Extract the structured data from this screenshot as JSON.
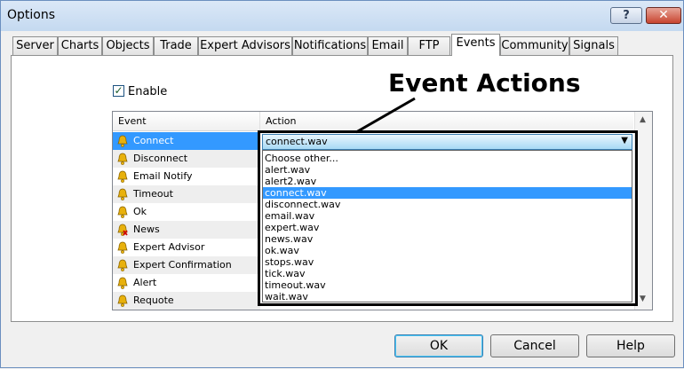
{
  "window": {
    "title": "Options",
    "help_glyph": "?",
    "close_glyph": "✕"
  },
  "tabs": [
    {
      "label": "Server"
    },
    {
      "label": "Charts"
    },
    {
      "label": "Objects"
    },
    {
      "label": "Trade"
    },
    {
      "label": "Expert Advisors"
    },
    {
      "label": "Notifications"
    },
    {
      "label": "Email"
    },
    {
      "label": "FTP"
    },
    {
      "label": "Events",
      "active": true
    },
    {
      "label": "Community"
    },
    {
      "label": "Signals"
    }
  ],
  "enable": {
    "label": "Enable",
    "checked": true
  },
  "annotation": "Event Actions",
  "list": {
    "columns": {
      "event": "Event",
      "action": "Action"
    },
    "events": [
      {
        "label": "Connect",
        "icon": "bell-icon",
        "selected": true
      },
      {
        "label": "Disconnect",
        "icon": "bell-icon"
      },
      {
        "label": "Email Notify",
        "icon": "bell-icon"
      },
      {
        "label": "Timeout",
        "icon": "bell-icon"
      },
      {
        "label": "Ok",
        "icon": "bell-icon"
      },
      {
        "label": "News",
        "icon": "bell-disabled-icon"
      },
      {
        "label": "Expert Advisor",
        "icon": "bell-icon"
      },
      {
        "label": "Expert Confirmation",
        "icon": "bell-icon"
      },
      {
        "label": "Alert",
        "icon": "bell-icon"
      },
      {
        "label": "Requote",
        "icon": "bell-icon"
      }
    ]
  },
  "action_combo": {
    "value": "connect.wav",
    "options": [
      "Choose other...",
      "alert.wav",
      "alert2.wav",
      "connect.wav",
      "disconnect.wav",
      "email.wav",
      "expert.wav",
      "news.wav",
      "ok.wav",
      "stops.wav",
      "tick.wav",
      "timeout.wav",
      "wait.wav"
    ],
    "selected_index": 3
  },
  "buttons": {
    "ok": "OK",
    "cancel": "Cancel",
    "help": "Help"
  },
  "colors": {
    "selection": "#3399ff",
    "bell": "#e8b10c"
  }
}
